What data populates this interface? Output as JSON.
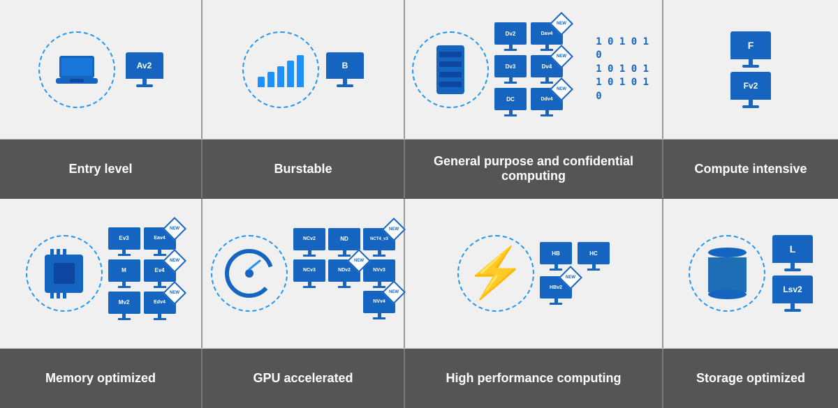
{
  "rows": {
    "top_icons": {
      "col1_label": "Entry level",
      "col2_label": "Burstable",
      "col3_label": "General purpose and confidential computing",
      "col4_label": "Compute intensive"
    },
    "bottom_icons": {
      "col1_label": "Memory optimized",
      "col2_label": "GPU accelerated",
      "col3_label": "High performance computing",
      "col4_label": "Storage optimized"
    }
  },
  "monitors": {
    "av2": "Av2",
    "b": "B",
    "dv2": "Dv2",
    "dav4": "Dav4",
    "dv3": "Dv3",
    "dv4": "Dv4",
    "dc": "DC",
    "ddv4": "Ddv4",
    "f": "F",
    "fv2": "Fv2",
    "ev3": "Ev3",
    "eav4": "Eav4",
    "m": "M",
    "ev4": "Ev4",
    "mv2": "Mv2",
    "edv4": "Edv4",
    "ncv2": "NCv2",
    "nd": "ND",
    "nct4v3": "NCT4_v3",
    "ncv3": "NCv3",
    "ndv2": "NDv2",
    "nvv3": "NVv3",
    "nvv4": "NVv4",
    "hb": "HB",
    "hc": "HC",
    "hbv2": "HBv2",
    "l": "L",
    "lsv2": "Lsv2"
  },
  "new_badges": [
    "Dav4",
    "Dv4",
    "Ddv4",
    "Eav4",
    "Ev4",
    "Edv4",
    "NCT4_v3",
    "NDv2",
    "NVv4",
    "HBv2"
  ],
  "binary": [
    "1 0 1 0 1 0",
    "1 0 1 0 1",
    "1 0 1 0 1 0"
  ]
}
